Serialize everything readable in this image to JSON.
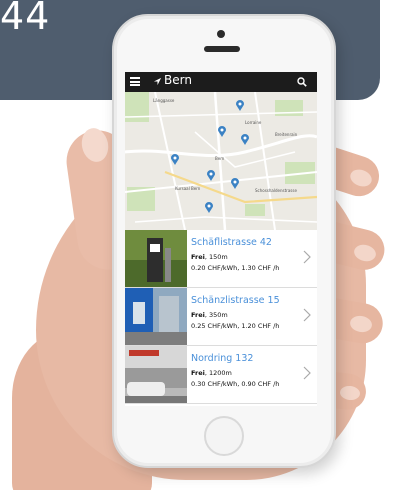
{
  "banner": {
    "text": "44"
  },
  "app": {
    "city": "Bern",
    "icons": {
      "menu": "menu-icon",
      "location": "location-arrow-icon",
      "search": "search-icon"
    }
  },
  "map": {
    "labels": [
      "Länggasse",
      "Kursaal Bern",
      "Schosshaldenstrasse",
      "Breitenrain",
      "Lorraine",
      "Bern"
    ]
  },
  "stations": [
    {
      "name": "Schäflistrasse 42",
      "status": "Frei",
      "distance": ", 150m",
      "price": "0.20 CHF/kWh, 1.30 CHF /h"
    },
    {
      "name": "Schänzlistrasse 15",
      "status": "Frei",
      "distance": ", 350m",
      "price": "0.25 CHF/kWh, 1.20 CHF /h"
    },
    {
      "name": "Nordring 132",
      "status": "Frei",
      "distance": ", 1200m",
      "price": "0.30 CHF/kWh, 0.90 CHF /h"
    }
  ],
  "colors": {
    "banner": "#4f5d6e",
    "accent": "#4a90d9",
    "appbar": "#1c1c1c",
    "pin": "#3b82c4"
  }
}
